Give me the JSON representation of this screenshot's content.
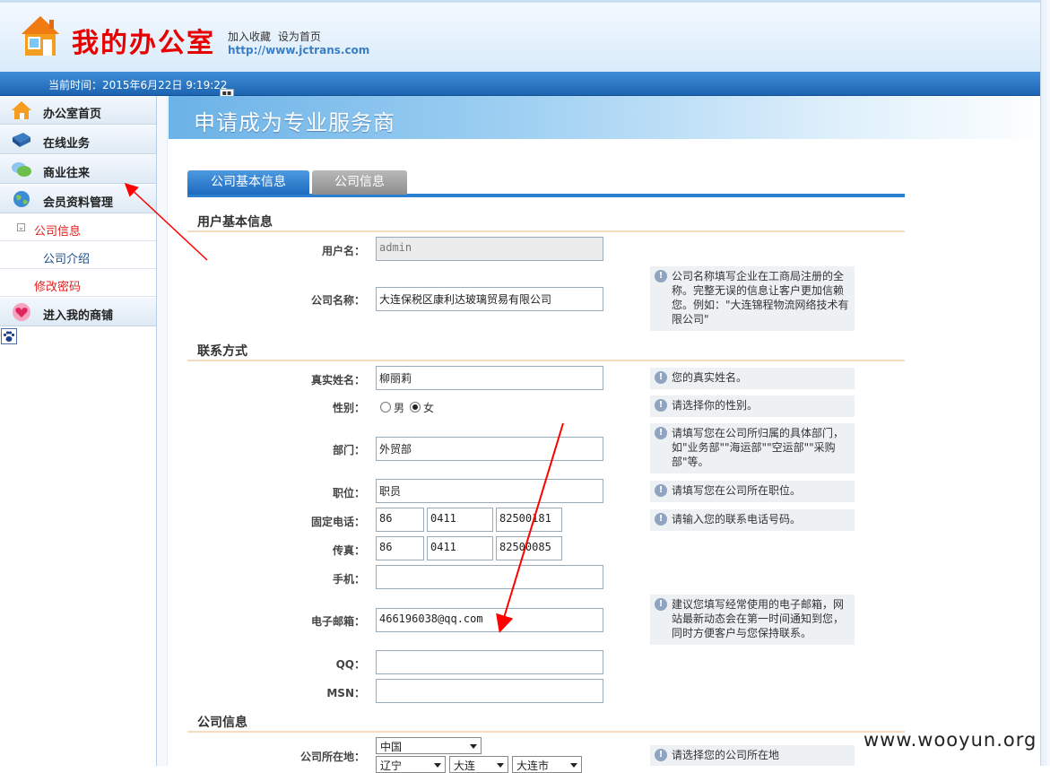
{
  "header": {
    "title": "我的办公室",
    "links": [
      "加入收藏",
      "设为首页"
    ],
    "url": "http://www.jctrans.com"
  },
  "bar": {
    "time_text": "当前时间：2015年6月22日 9:19:22"
  },
  "sidebar": {
    "items": [
      {
        "label": "办公室首页",
        "icon": "house-icon"
      },
      {
        "label": "在线业务",
        "icon": "book-icon"
      },
      {
        "label": "商业往来",
        "icon": "chat-icon"
      },
      {
        "label": "会员资料管理",
        "icon": "globe-icon"
      }
    ],
    "sub_group": "公司信息",
    "sub_item": "公司介绍",
    "change_password": "修改密码",
    "shop": {
      "label": "进入我的商铺",
      "icon": "heart-icon"
    }
  },
  "page": {
    "banner_title": "申请成为专业服务商",
    "tabs": [
      "公司基本信息",
      "公司信息"
    ],
    "section_user": "用户基本信息",
    "section_contact": "联系方式",
    "section_company": "公司信息"
  },
  "form": {
    "username": {
      "label": "用户名：",
      "value": "admin"
    },
    "company_name": {
      "label": "公司名称：",
      "value": "大连保税区康利达玻璃贸易有限公司",
      "tip": "公司名称填写企业在工商局注册的全称。完整无误的信息让客户更加信赖您。例如：\"大连锦程物流网络技术有限公司\""
    },
    "real_name": {
      "label": "真实姓名：",
      "value": "柳丽莉",
      "tip": "您的真实姓名。"
    },
    "gender": {
      "label": "性别：",
      "options": [
        "男",
        "女"
      ],
      "selected": "女",
      "tip": "请选择你的性别。"
    },
    "department": {
      "label": "部门：",
      "value": "外贸部",
      "tip": "请填写您在公司所归属的具体部门，如\"业务部\"\"海运部\"\"空运部\"\"采购部\"等。"
    },
    "position": {
      "label": "职位：",
      "value": "职员",
      "tip": "请填写您在公司所在职位。"
    },
    "phone": {
      "label": "固定电话：",
      "country": "86",
      "area": "0411",
      "number": "82500181",
      "tip": "请输入您的联系电话号码。"
    },
    "fax": {
      "label": "传真：",
      "country": "86",
      "area": "0411",
      "number": "82500085"
    },
    "mobile": {
      "label": "手机：",
      "value": ""
    },
    "email": {
      "label": "电子邮箱：",
      "value": "466196038@qq.com",
      "tip": "建议您填写经常使用的电子邮箱，网站最新动态会在第一时间通知到您，同时方便客户与您保持联系。"
    },
    "qq": {
      "label": "QQ：",
      "value": ""
    },
    "msn": {
      "label": "MSN：",
      "value": ""
    },
    "location": {
      "label": "公司所在地：",
      "country": "中国",
      "province": "辽宁",
      "city": "大连",
      "district": "大连市",
      "tip": "请选择您的公司所在地"
    }
  },
  "watermark": "www.wooyun.org",
  "colors": {
    "accent": "#2b7fd0",
    "brand_red": "#e60000",
    "annotation": "#ff0000"
  }
}
